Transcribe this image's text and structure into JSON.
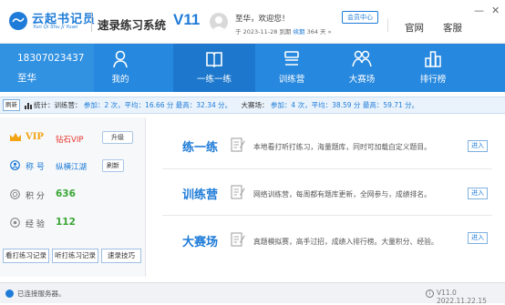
{
  "app": {
    "logo_text": "云起书记员",
    "logo_sub": "Yun Qi Shu Ji Yuan",
    "system_name": "速录练习系统",
    "version_badge": "V11"
  },
  "user": {
    "greeting": "至华，欢迎您！",
    "vip_expiry_date": "于 2023-11-28 到期",
    "renew_label": "续期",
    "remaining": "364 天",
    "phone": "18307023437",
    "name": "至华",
    "vip_label": "VIP",
    "vip_level": "钻石VIP",
    "upgrade_label": "升级",
    "nickname_label": "称  号",
    "nickname": "纵横江湖",
    "refresh_label": "刷新",
    "points_label": "积  分",
    "points": "636",
    "exp_label": "经  验",
    "exp": "112"
  },
  "header": {
    "member_center": "会员中心",
    "official_site": "官网",
    "customer_service": "客服",
    "minimize": "—",
    "close": "✕"
  },
  "nav": {
    "items": [
      {
        "label": "我的",
        "icon": "user-icon"
      },
      {
        "label": "一练一练",
        "icon": "book-icon"
      },
      {
        "label": "训练营",
        "icon": "stack-icon"
      },
      {
        "label": "大赛场",
        "icon": "group-icon"
      },
      {
        "label": "排行榜",
        "icon": "ranking-icon"
      }
    ]
  },
  "stats": {
    "refresh_label": "刷新",
    "prefix": "统计：训练营：",
    "camp_participate": "参加：2 次，平均：16.66 分 最高：32.34 分。",
    "contest_prefix": "大赛场：",
    "contest_participate": "参加：4 次，平均：38.59 分 最高：59.71 分。"
  },
  "records": {
    "buttons": [
      "看打练习记录",
      "听打练习记录",
      "速录技巧"
    ]
  },
  "modes": [
    {
      "title": "练一练",
      "desc": "本地看打听打练习，海量题库，同时可加载自定义题目。",
      "enter": "进入"
    },
    {
      "title": "训练营",
      "desc": "网络训练营，每周都有题库更新，全网参与，成绩排名。",
      "enter": "进入"
    },
    {
      "title": "大赛场",
      "desc": "真题模拟赛，高手过招，成绩入排行榜。大量积分、经验。",
      "enter": "进入"
    }
  ],
  "status": {
    "connection": "已连接服务器。",
    "version": "V11.0 2022.11.22.15"
  },
  "colors": {
    "primary": "#1e7bd8",
    "nav_bg": "#2688de",
    "nav_active": "#1d78cd",
    "vip_gold": "#f2a414",
    "vip_red": "#e6332a",
    "value_green": "#3aa636"
  }
}
